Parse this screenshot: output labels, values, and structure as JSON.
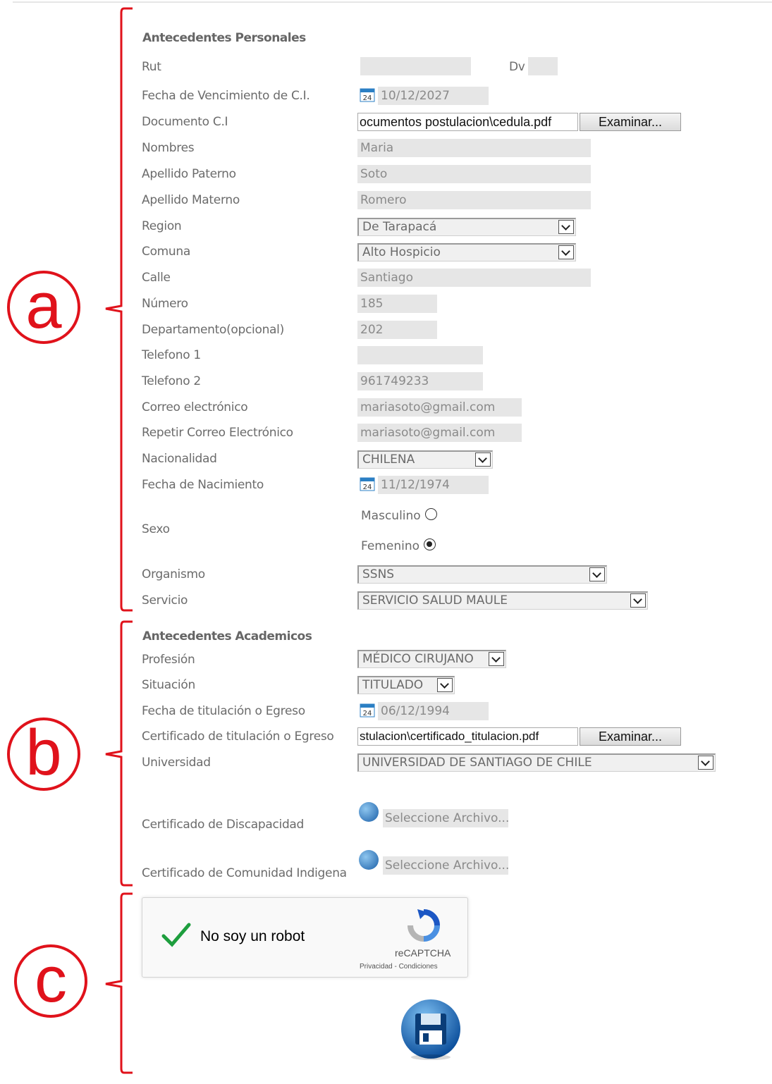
{
  "annotations": [
    "a",
    "b",
    "c"
  ],
  "personal": {
    "title": "Antecedentes Personales",
    "rut_label": "Rut",
    "rut_value": "",
    "dv_label": "Dv",
    "dv_value": "",
    "ci_expiry_label": "Fecha de Vencimiento de C.I.",
    "ci_expiry_value": "10/12/2027",
    "doc_ci_label": "Documento C.I",
    "doc_ci_file": "ocumentos postulacion\\cedula.pdf",
    "browse_label": "Examinar...",
    "nombres_label": "Nombres",
    "nombres_value": "Maria",
    "paterno_label": "Apellido Paterno",
    "paterno_value": "Soto",
    "materno_label": "Apellido Materno",
    "materno_value": "Romero",
    "region_label": "Region",
    "region_value": "De Tarapacá",
    "comuna_label": "Comuna",
    "comuna_value": "Alto Hospicio",
    "calle_label": "Calle",
    "calle_value": "Santiago",
    "numero_label": "Número",
    "numero_value": "185",
    "depto_label": "Departamento(opcional)",
    "depto_value": "202",
    "tel1_label": "Telefono 1",
    "tel1_value": "",
    "tel2_label": "Telefono 2",
    "tel2_value": "961749233",
    "email_label": "Correo electrónico",
    "email_value": "mariasoto@gmail.com",
    "email2_label": "Repetir Correo Electrónico",
    "email2_value": "mariasoto@gmail.com",
    "nacionalidad_label": "Nacionalidad",
    "nacionalidad_value": "CHILENA",
    "nacimiento_label": "Fecha de Nacimiento",
    "nacimiento_value": "11/12/1974",
    "sexo_label": "Sexo",
    "masculino_label": "Masculino",
    "femenino_label": "Femenino",
    "sexo_selected": "Femenino",
    "organismo_label": "Organismo",
    "organismo_value": "SSNS",
    "servicio_label": "Servicio",
    "servicio_value": "SERVICIO SALUD MAULE"
  },
  "academic": {
    "title": "Antecedentes Academicos",
    "profesion_label": "Profesión",
    "profesion_value": "MÉDICO CIRUJANO",
    "situacion_label": "Situación",
    "situacion_value": "TITULADO",
    "fecha_titulo_label": "Fecha de titulación o Egreso",
    "fecha_titulo_value": "06/12/1994",
    "cert_titulo_label": "Certificado de titulación o Egreso",
    "cert_titulo_file": "stulacion\\certificado_titulacion.pdf",
    "browse_label": "Examinar...",
    "universidad_label": "Universidad",
    "universidad_value": "UNIVERSIDAD DE SANTIAGO DE CHILE",
    "discapacidad_label": "Certificado de Discapacidad",
    "indigena_label": "Certificado de Comunidad Indigena",
    "select_file_label": "Seleccione Archivo..."
  },
  "captcha": {
    "label": "No soy un robot",
    "brand": "reCAPTCHA",
    "terms": "Privacidad - Condiciones"
  },
  "colors": {
    "annotation": "#e0121b",
    "field_bg": "#e6e6e6"
  }
}
